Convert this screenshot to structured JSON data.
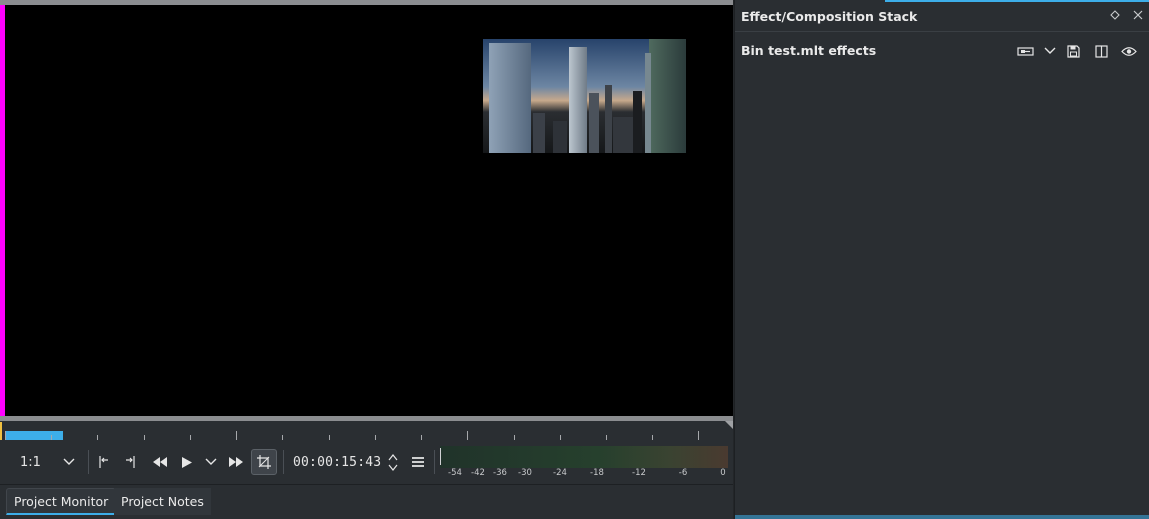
{
  "monitor": {
    "toolbar": {
      "zoom_label": "1:1",
      "timecode": "00:00:15:43",
      "audio_meter_db_labels": [
        "-54",
        "-42",
        "-36",
        "-30",
        "-24",
        "-18",
        "-12",
        "-6",
        "0"
      ]
    },
    "tabs": [
      {
        "label": "Project Monitor",
        "active": true
      },
      {
        "label": "Project Notes",
        "active": false
      }
    ],
    "preview": {
      "subject": "city skyline with skyscrapers at dusk"
    }
  },
  "effect_stack": {
    "title": "Effect/Composition Stack",
    "bin_label": "Bin test.mlt effects"
  },
  "colors": {
    "accent": "#3daee9",
    "monitor_edge": "#ff00ff",
    "panel_bg": "#2a2e32"
  }
}
